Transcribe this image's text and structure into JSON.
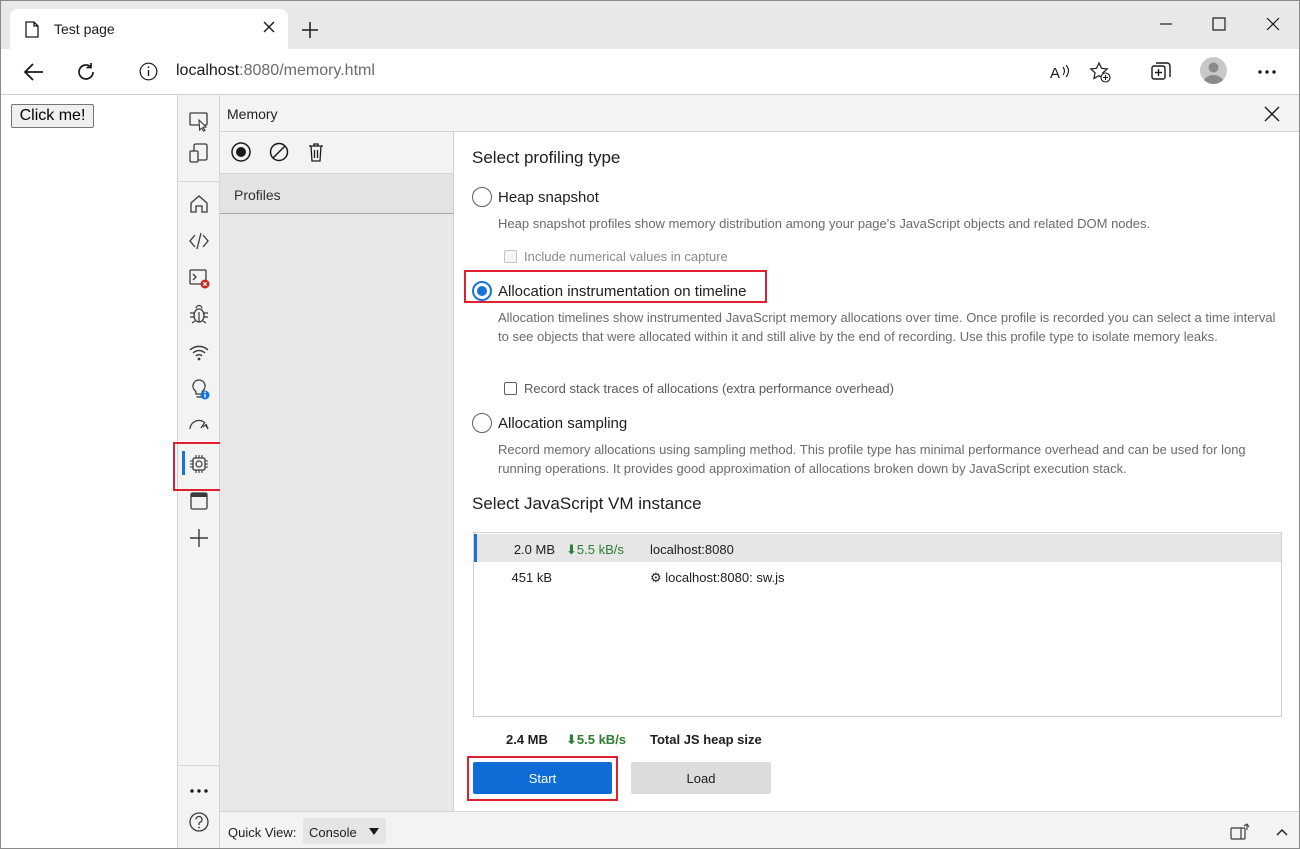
{
  "browser": {
    "tab_title": "Test page",
    "url_host": "localhost",
    "url_path": ":8080/memory.html"
  },
  "page": {
    "button_label": "Click me!"
  },
  "devtools": {
    "panel_title": "Memory",
    "sidebar": {
      "profiles_label": "Profiles"
    },
    "profiling": {
      "heading": "Select profiling type",
      "options": [
        {
          "label": "Heap snapshot",
          "description": "Heap snapshot profiles show memory distribution among your page's JavaScript objects and related DOM nodes.",
          "checkbox_label": "Include numerical values in capture",
          "checked": false
        },
        {
          "label": "Allocation instrumentation on timeline",
          "description": "Allocation timelines show instrumented JavaScript memory allocations over time. Once profile is recorded you can select a time interval to see objects that were allocated within it and still alive by the end of recording. Use this profile type to isolate memory leaks.",
          "checkbox_label": "Record stack traces of allocations (extra performance overhead)",
          "checked": true
        },
        {
          "label": "Allocation sampling",
          "description": "Record memory allocations using sampling method. This profile type has minimal performance overhead and can be used for long running operations. It provides good approximation of allocations broken down by JavaScript execution stack.",
          "checked": false
        }
      ]
    },
    "vm": {
      "heading": "Select JavaScript VM instance",
      "rows": [
        {
          "size": "2.0 MB",
          "rate": "⬇5.5 kB/s",
          "url": "localhost:8080",
          "selected": true
        },
        {
          "size": "451 kB",
          "rate": "",
          "url": "⚙ localhost:8080: sw.js",
          "selected": false
        }
      ],
      "total_size": "2.4 MB",
      "total_rate": "⬇5.5 kB/s",
      "total_label": "Total JS heap size"
    },
    "buttons": {
      "start": "Start",
      "load": "Load"
    },
    "quick_view": {
      "label": "Quick View:",
      "value": "Console"
    }
  },
  "colors": {
    "accent": "#0f6cd6",
    "highlight_box": "#e0202e",
    "rate_green": "#2e7d32"
  }
}
